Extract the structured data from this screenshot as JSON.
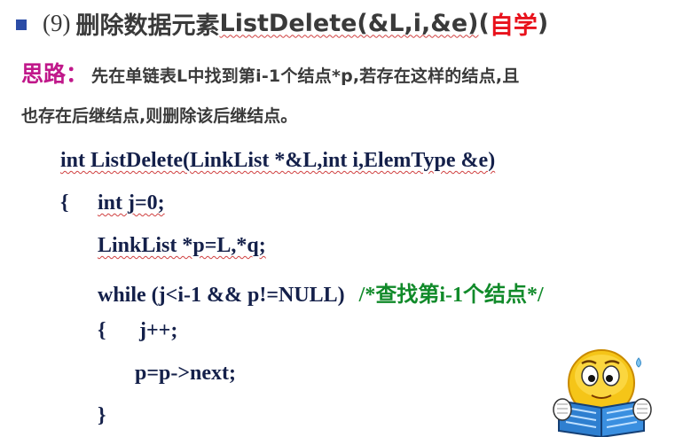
{
  "title": {
    "number": "(9)",
    "text": "删除数据元素",
    "func": "ListDelete(&L,i,&e)",
    "paren_open": "(",
    "self_study": "自学",
    "paren_close": ")"
  },
  "idea": {
    "label": "思路：",
    "line1": "先在单链表L中找到第i-1个结点*p,若存在这样的结点,且",
    "line2": "也存在后继结点,则删除该后继结点。"
  },
  "code": {
    "line1": "int ListDelete(LinkList *&L,int i,ElemType &e)",
    "line2_brace": "{",
    "line2": "int j=0;",
    "line3": "LinkList *p=L,*q;",
    "line4": "while (j<i-1 && p!=NULL)",
    "line4_comment": "/*查找第i-1个结点*/",
    "line5_brace": "{",
    "line5": "j++;",
    "line6": "p=p->next;",
    "line7": "}"
  },
  "colors": {
    "bullet": "#2b4ca6",
    "idea_label": "#c0188a",
    "self_study": "#e8121c",
    "code": "#14204a",
    "comment": "#118a2a"
  },
  "decoration": "smiley-reading-book-icon"
}
